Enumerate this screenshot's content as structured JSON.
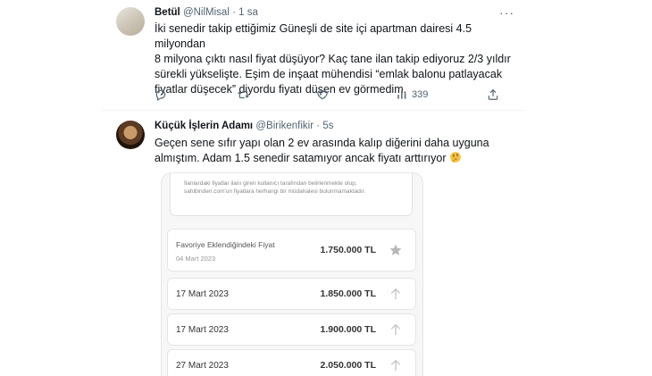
{
  "tweet1": {
    "name": "Betül",
    "handle": "@NilMisal",
    "separator": "·",
    "time": "1 sa",
    "lines": [
      "İki senedir takip ettiğimiz Güneşli de site içi apartman dairesi 4.5 milyondan",
      "8 milyona çıktı nasıl fiyat düşüyor? Kaç tane ilan takip ediyoruz 2/3 yıldır",
      "sürekli yükselişte. Eşim de inşaat mühendisi “emlak balonu patlayacak",
      "fiyatlar düşecek” diyordu fiyatı düşen ev görmedim."
    ],
    "views": "339"
  },
  "tweet2": {
    "name": "Küçük İşlerin Adamı",
    "handle": "@Birikenfikir",
    "separator": "·",
    "time": "5s",
    "lines": [
      "Geçen sene sıfır yapı olan 2 ev arasında kalıp diğerini daha uyguna",
      "almıştım. Adam 1.5 senedir satamıyor ancak fiyatı arttırıyor"
    ],
    "notice_lines": [
      "İlanlardaki fiyatlar ilanı giren kullanıcı tarafından belirlenmekte olup,",
      "sahibinden.com'un fiyatlara herhangi bir müdahalesi bulunmamaktadır."
    ],
    "favorite_label": "Favoriye Eklendiğindeki Fiyat",
    "favorite_date": "04 Mart 2023",
    "favorite_price": "1.750.000 TL",
    "price_rows": [
      {
        "date": "17 Mart 2023",
        "price": "1.850.000 TL"
      },
      {
        "date": "17 Mart 2023",
        "price": "1.900.000 TL"
      },
      {
        "date": "27 Mart 2023",
        "price": "2.050.000 TL"
      }
    ]
  }
}
